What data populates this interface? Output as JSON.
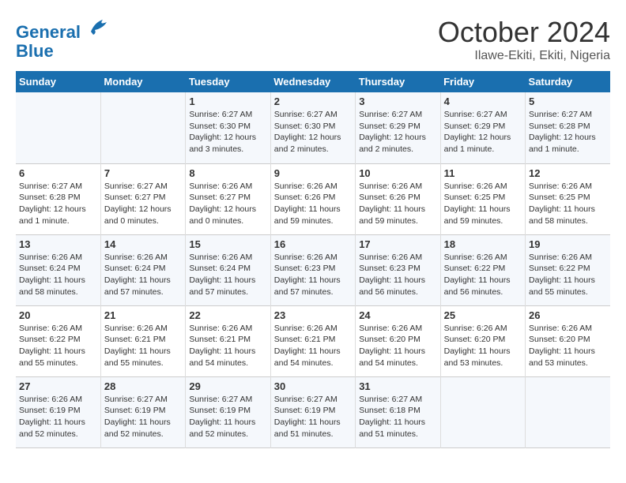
{
  "header": {
    "logo_line1": "General",
    "logo_line2": "Blue",
    "month": "October 2024",
    "location": "Ilawe-Ekiti, Ekiti, Nigeria"
  },
  "weekdays": [
    "Sunday",
    "Monday",
    "Tuesday",
    "Wednesday",
    "Thursday",
    "Friday",
    "Saturday"
  ],
  "weeks": [
    [
      {
        "day": "",
        "info": ""
      },
      {
        "day": "",
        "info": ""
      },
      {
        "day": "1",
        "info": "Sunrise: 6:27 AM\nSunset: 6:30 PM\nDaylight: 12 hours\nand 3 minutes."
      },
      {
        "day": "2",
        "info": "Sunrise: 6:27 AM\nSunset: 6:30 PM\nDaylight: 12 hours\nand 2 minutes."
      },
      {
        "day": "3",
        "info": "Sunrise: 6:27 AM\nSunset: 6:29 PM\nDaylight: 12 hours\nand 2 minutes."
      },
      {
        "day": "4",
        "info": "Sunrise: 6:27 AM\nSunset: 6:29 PM\nDaylight: 12 hours\nand 1 minute."
      },
      {
        "day": "5",
        "info": "Sunrise: 6:27 AM\nSunset: 6:28 PM\nDaylight: 12 hours\nand 1 minute."
      }
    ],
    [
      {
        "day": "6",
        "info": "Sunrise: 6:27 AM\nSunset: 6:28 PM\nDaylight: 12 hours\nand 1 minute."
      },
      {
        "day": "7",
        "info": "Sunrise: 6:27 AM\nSunset: 6:27 PM\nDaylight: 12 hours\nand 0 minutes."
      },
      {
        "day": "8",
        "info": "Sunrise: 6:26 AM\nSunset: 6:27 PM\nDaylight: 12 hours\nand 0 minutes."
      },
      {
        "day": "9",
        "info": "Sunrise: 6:26 AM\nSunset: 6:26 PM\nDaylight: 11 hours\nand 59 minutes."
      },
      {
        "day": "10",
        "info": "Sunrise: 6:26 AM\nSunset: 6:26 PM\nDaylight: 11 hours\nand 59 minutes."
      },
      {
        "day": "11",
        "info": "Sunrise: 6:26 AM\nSunset: 6:25 PM\nDaylight: 11 hours\nand 59 minutes."
      },
      {
        "day": "12",
        "info": "Sunrise: 6:26 AM\nSunset: 6:25 PM\nDaylight: 11 hours\nand 58 minutes."
      }
    ],
    [
      {
        "day": "13",
        "info": "Sunrise: 6:26 AM\nSunset: 6:24 PM\nDaylight: 11 hours\nand 58 minutes."
      },
      {
        "day": "14",
        "info": "Sunrise: 6:26 AM\nSunset: 6:24 PM\nDaylight: 11 hours\nand 57 minutes."
      },
      {
        "day": "15",
        "info": "Sunrise: 6:26 AM\nSunset: 6:24 PM\nDaylight: 11 hours\nand 57 minutes."
      },
      {
        "day": "16",
        "info": "Sunrise: 6:26 AM\nSunset: 6:23 PM\nDaylight: 11 hours\nand 57 minutes."
      },
      {
        "day": "17",
        "info": "Sunrise: 6:26 AM\nSunset: 6:23 PM\nDaylight: 11 hours\nand 56 minutes."
      },
      {
        "day": "18",
        "info": "Sunrise: 6:26 AM\nSunset: 6:22 PM\nDaylight: 11 hours\nand 56 minutes."
      },
      {
        "day": "19",
        "info": "Sunrise: 6:26 AM\nSunset: 6:22 PM\nDaylight: 11 hours\nand 55 minutes."
      }
    ],
    [
      {
        "day": "20",
        "info": "Sunrise: 6:26 AM\nSunset: 6:22 PM\nDaylight: 11 hours\nand 55 minutes."
      },
      {
        "day": "21",
        "info": "Sunrise: 6:26 AM\nSunset: 6:21 PM\nDaylight: 11 hours\nand 55 minutes."
      },
      {
        "day": "22",
        "info": "Sunrise: 6:26 AM\nSunset: 6:21 PM\nDaylight: 11 hours\nand 54 minutes."
      },
      {
        "day": "23",
        "info": "Sunrise: 6:26 AM\nSunset: 6:21 PM\nDaylight: 11 hours\nand 54 minutes."
      },
      {
        "day": "24",
        "info": "Sunrise: 6:26 AM\nSunset: 6:20 PM\nDaylight: 11 hours\nand 54 minutes."
      },
      {
        "day": "25",
        "info": "Sunrise: 6:26 AM\nSunset: 6:20 PM\nDaylight: 11 hours\nand 53 minutes."
      },
      {
        "day": "26",
        "info": "Sunrise: 6:26 AM\nSunset: 6:20 PM\nDaylight: 11 hours\nand 53 minutes."
      }
    ],
    [
      {
        "day": "27",
        "info": "Sunrise: 6:26 AM\nSunset: 6:19 PM\nDaylight: 11 hours\nand 52 minutes."
      },
      {
        "day": "28",
        "info": "Sunrise: 6:27 AM\nSunset: 6:19 PM\nDaylight: 11 hours\nand 52 minutes."
      },
      {
        "day": "29",
        "info": "Sunrise: 6:27 AM\nSunset: 6:19 PM\nDaylight: 11 hours\nand 52 minutes."
      },
      {
        "day": "30",
        "info": "Sunrise: 6:27 AM\nSunset: 6:19 PM\nDaylight: 11 hours\nand 51 minutes."
      },
      {
        "day": "31",
        "info": "Sunrise: 6:27 AM\nSunset: 6:18 PM\nDaylight: 11 hours\nand 51 minutes."
      },
      {
        "day": "",
        "info": ""
      },
      {
        "day": "",
        "info": ""
      }
    ]
  ]
}
